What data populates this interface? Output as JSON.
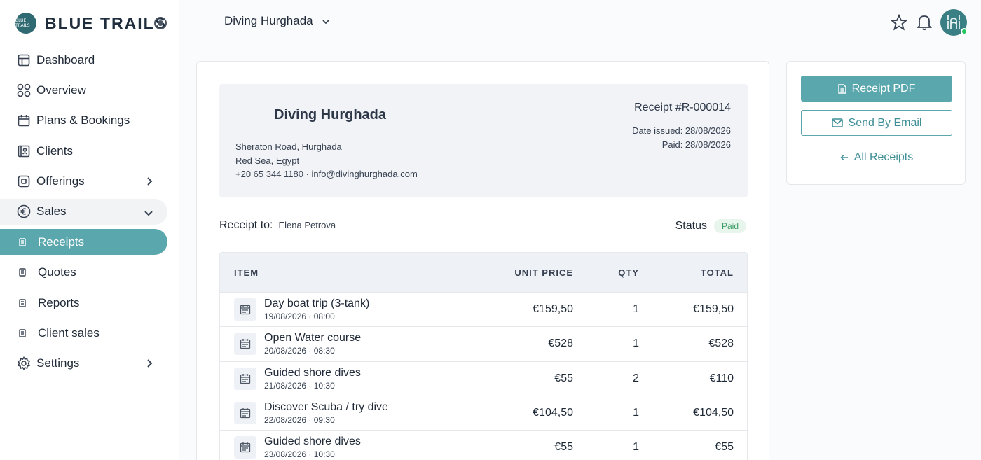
{
  "brand": {
    "name": "BLUE TRAILS",
    "logo_text": "BLUE TRAILS"
  },
  "sidebar": {
    "items": [
      {
        "label": "Dashboard",
        "icon": "grid-icon"
      },
      {
        "label": "Overview",
        "icon": "apps-icon"
      },
      {
        "label": "Plans & Bookings",
        "icon": "calendar-icon"
      },
      {
        "label": "Clients",
        "icon": "user-card-icon"
      },
      {
        "label": "Offerings",
        "icon": "package-icon"
      },
      {
        "label": "Sales",
        "icon": "euro-circle-icon"
      },
      {
        "label": "Receipts"
      },
      {
        "label": "Quotes"
      },
      {
        "label": "Reports"
      },
      {
        "label": "Client sales"
      },
      {
        "label": "Settings",
        "icon": "gear-icon"
      }
    ]
  },
  "topbar": {
    "business_select": "Diving Hurghada"
  },
  "receipt": {
    "company": {
      "name": "Diving Hurghada",
      "address_line1": "Sheraton Road, Hurghada",
      "address_line2": "Red Sea, Egypt",
      "contact": "+20 65 344 1180 · info@divinghurghada.com"
    },
    "title": "Receipt #R-000014",
    "date_issued": "Date issued: 28/08/2026",
    "date_paid": "Paid: 28/08/2026",
    "to_label": "Receipt to:",
    "to_name": "Elena Petrova",
    "status_label": "Status",
    "status_value": "Paid",
    "status_color": "#3b9b64",
    "columns": {
      "item": "ITEM",
      "unit_price": "UNIT PRICE",
      "qty": "QTY",
      "total": "TOTAL"
    },
    "rows": [
      {
        "name": "Day boat trip (3-tank)",
        "sub": "19/08/2026 · 08:00",
        "unit_price": "€159,50",
        "qty": "1",
        "total": "€159,50"
      },
      {
        "name": "Open Water course",
        "sub": "20/08/2026 · 08:30",
        "unit_price": "€528",
        "qty": "1",
        "total": "€528"
      },
      {
        "name": "Guided shore dives",
        "sub": "21/08/2026 · 10:30",
        "unit_price": "€55",
        "qty": "2",
        "total": "€110"
      },
      {
        "name": "Discover Scuba / try dive",
        "sub": "22/08/2026 · 09:30",
        "unit_price": "€104,50",
        "qty": "1",
        "total": "€104,50"
      },
      {
        "name": "Guided shore dives",
        "sub": "23/08/2026 · 10:30",
        "unit_price": "€55",
        "qty": "1",
        "total": "€55"
      }
    ]
  },
  "actions": {
    "pdf": "Receipt PDF",
    "email": "Send By Email",
    "all": "All Receipts"
  },
  "colors": {
    "accent": "#5aa7ad",
    "active_nav": "#5aa7ad",
    "online": "#22c55e"
  }
}
